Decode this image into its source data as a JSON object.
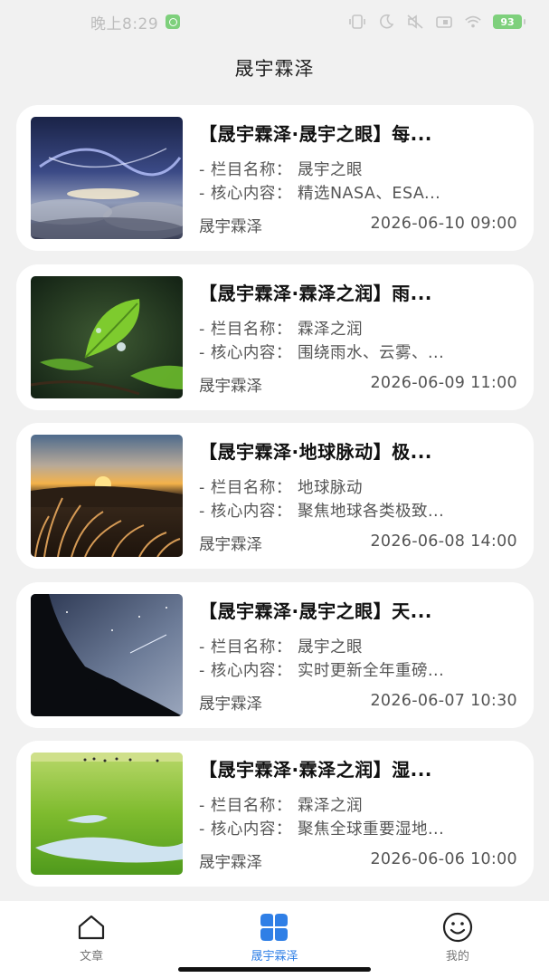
{
  "status_bar": {
    "time": "晚上8:29",
    "battery": "93",
    "icons": [
      "vibrate-icon",
      "moon-icon",
      "mute-icon",
      "sim-icon",
      "wifi-icon",
      "battery-icon"
    ]
  },
  "header": {
    "title": "晟宇霖泽"
  },
  "articles": [
    {
      "title": "【晟宇霖泽·晟宇之眼】每...",
      "line1": "- 栏目名称： 晟宇之眼",
      "line2": "- 核心内容： 精选NASA、ESA...",
      "author": "晟宇霖泽",
      "date": "2026-06-10 09:00",
      "image": "galaxy-clouds"
    },
    {
      "title": "【晟宇霖泽·霖泽之润】雨...",
      "line1": "- 栏目名称： 霖泽之润",
      "line2": "- 核心内容： 围绕雨水、云雾、...",
      "author": "晟宇霖泽",
      "date": "2026-06-09 11:00",
      "image": "leaf-raindrop"
    },
    {
      "title": "【晟宇霖泽·地球脉动】极...",
      "line1": "- 栏目名称： 地球脉动",
      "line2": "- 核心内容： 聚焦地球各类极致...",
      "author": "晟宇霖泽",
      "date": "2026-06-08 14:00",
      "image": "sunset-grass"
    },
    {
      "title": "【晟宇霖泽·晟宇之眼】天...",
      "line1": "- 栏目名称： 晟宇之眼",
      "line2": "- 核心内容： 实时更新全年重磅...",
      "author": "晟宇霖泽",
      "date": "2026-06-07 10:30",
      "image": "night-sky-trees"
    },
    {
      "title": "【晟宇霖泽·霖泽之润】湿...",
      "line1": "- 栏目名称： 霖泽之润",
      "line2": "- 核心内容： 聚焦全球重要湿地...",
      "author": "晟宇霖泽",
      "date": "2026-06-06 10:00",
      "image": "green-wetland"
    }
  ],
  "nav": [
    {
      "label": "文章",
      "icon": "home-icon",
      "active": false
    },
    {
      "label": "晟宇霖泽",
      "icon": "clover-icon",
      "active": true
    },
    {
      "label": "我的",
      "icon": "smile-icon",
      "active": false
    }
  ],
  "colors": {
    "accent": "#2f7fe6",
    "background": "#f1f1f1",
    "card": "#ffffff"
  }
}
